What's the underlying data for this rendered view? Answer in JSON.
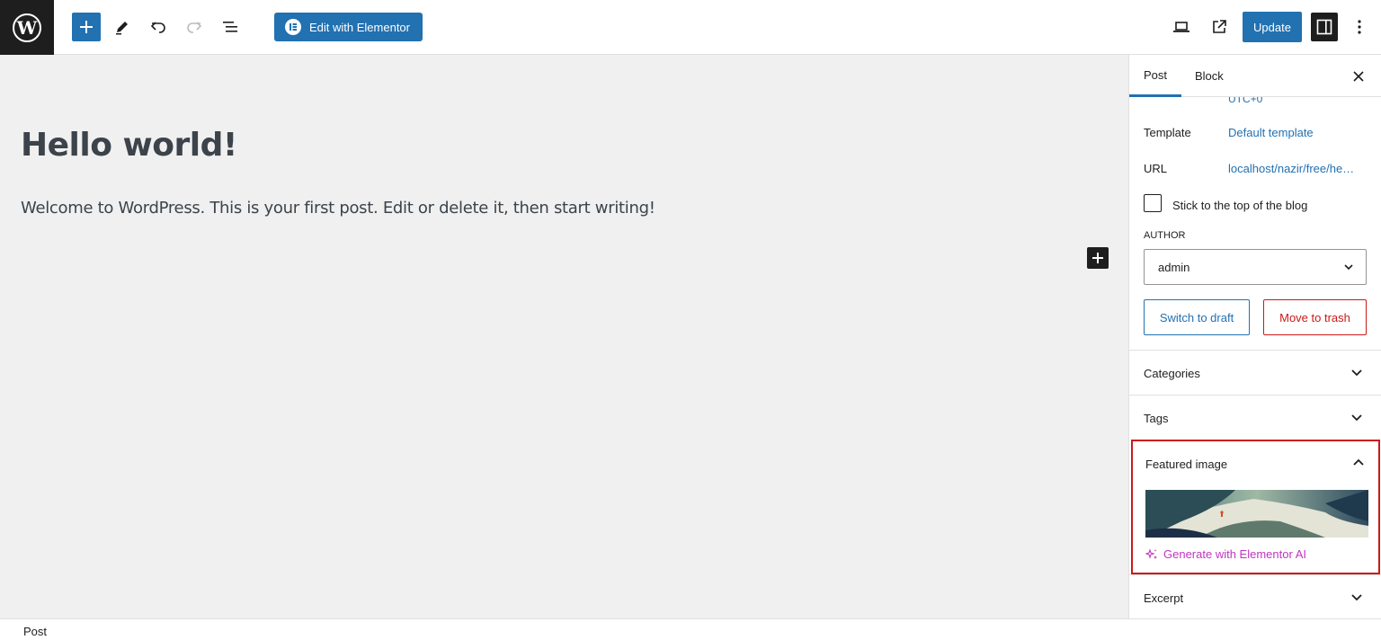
{
  "toolbar": {
    "add_block_icon": "plus-icon",
    "tools_icon": "pencil-icon",
    "undo_icon": "undo-icon",
    "redo_icon": "redo-icon",
    "list_view_icon": "list-view-icon",
    "elementor_label": "Edit with Elementor",
    "view_icon": "laptop-icon",
    "preview_icon": "external-link-icon",
    "update_label": "Update",
    "settings_icon": "sidebar-toggle-icon",
    "options_icon": "vertical-ellipsis-icon"
  },
  "editor": {
    "title": "Hello world!",
    "paragraph": "Welcome to WordPress. This is your first post. Edit or delete it, then start writing!"
  },
  "sidebar": {
    "tabs": [
      {
        "label": "Post"
      },
      {
        "label": "Block"
      }
    ],
    "timezone_partial": "UTC+0",
    "template_label": "Template",
    "template_value": "Default template",
    "url_label": "URL",
    "url_value": "localhost/nazir/free/he…",
    "sticky_label": "Stick to the top of the blog",
    "author_label": "AUTHOR",
    "author_value": "admin",
    "switch_draft_label": "Switch to draft",
    "move_trash_label": "Move to trash",
    "panels": [
      {
        "label": "Categories"
      },
      {
        "label": "Tags"
      },
      {
        "label": "Featured image"
      },
      {
        "label": "Excerpt"
      }
    ],
    "generate_ai_label": "Generate with Elementor AI"
  },
  "footer": {
    "breadcrumb": "Post"
  },
  "colors": {
    "accent": "#2271b1",
    "danger": "#cc1818",
    "elementor_ai": "#c036c0",
    "dark": "#1e1e1e",
    "canvas": "#f0f0f0"
  }
}
